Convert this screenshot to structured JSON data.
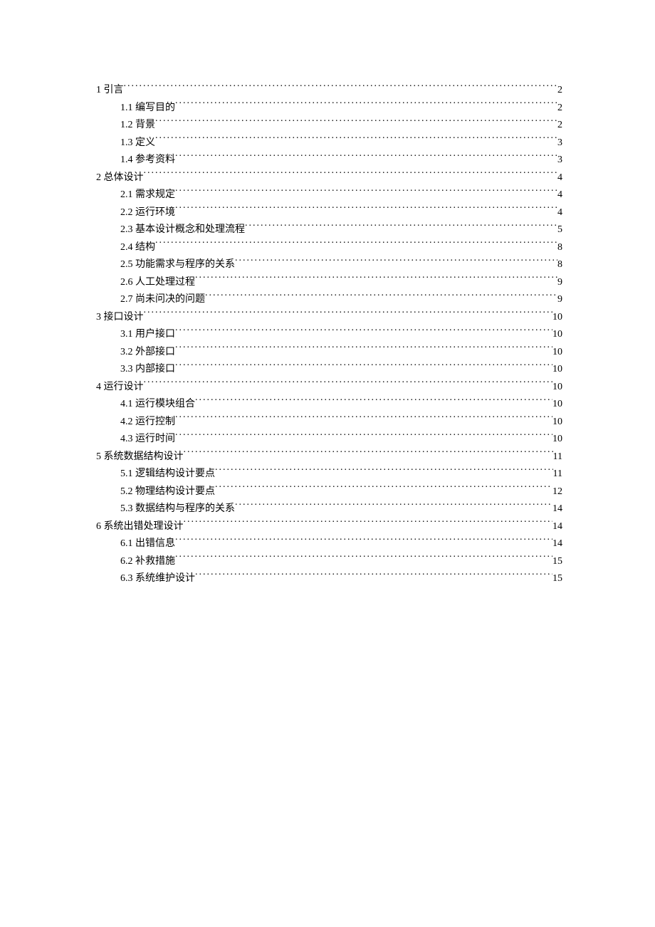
{
  "toc": [
    {
      "level": 1,
      "title": "1 引言",
      "page": "2"
    },
    {
      "level": 2,
      "title": "1.1 编写目的",
      "page": "2"
    },
    {
      "level": 2,
      "title": "1.2 背景",
      "page": "2"
    },
    {
      "level": 2,
      "title": "1.3 定义",
      "page": "3"
    },
    {
      "level": 2,
      "title": "1.4 参考资料",
      "page": "3"
    },
    {
      "level": 1,
      "title": "2 总体设计",
      "page": "4"
    },
    {
      "level": 2,
      "title": "2.1 需求规定",
      "page": "4"
    },
    {
      "level": 2,
      "title": "2.2 运行环境",
      "page": "4"
    },
    {
      "level": 2,
      "title": "2.3 基本设计概念和处理流程",
      "page": "5"
    },
    {
      "level": 2,
      "title": "2.4 结构",
      "page": "8"
    },
    {
      "level": 2,
      "title": "2.5 功能需求与程序的关系",
      "page": "8"
    },
    {
      "level": 2,
      "title": "2.6 人工处理过程",
      "page": "9"
    },
    {
      "level": 2,
      "title": "2.7 尚未问决的问题",
      "page": "9"
    },
    {
      "level": 1,
      "title": "3 接口设计",
      "page": "10"
    },
    {
      "level": 2,
      "title": "3.1 用户接口",
      "page": "10"
    },
    {
      "level": 2,
      "title": "3.2 外部接口",
      "page": "10"
    },
    {
      "level": 2,
      "title": "3.3 内部接口",
      "page": "10"
    },
    {
      "level": 1,
      "title": "4 运行设计",
      "page": "10"
    },
    {
      "level": 2,
      "title": "4.1 运行模块组合",
      "page": "10"
    },
    {
      "level": 2,
      "title": "4.2 运行控制",
      "page": "10"
    },
    {
      "level": 2,
      "title": "4.3 运行时间",
      "page": "10"
    },
    {
      "level": 1,
      "title": "5 系统数据结构设计",
      "page": "11"
    },
    {
      "level": 2,
      "title": "5.1 逻辑结构设计要点",
      "page": "11"
    },
    {
      "level": 2,
      "title": "5.2 物理结构设计要点",
      "page": "12"
    },
    {
      "level": 2,
      "title": "5.3 数据结构与程序的关系",
      "page": "14"
    },
    {
      "level": 1,
      "title": "6 系统出错处理设计",
      "page": "14"
    },
    {
      "level": 2,
      "title": "6.1 出错信息",
      "page": "14"
    },
    {
      "level": 2,
      "title": "6.2 补救措施",
      "page": "15"
    },
    {
      "level": 2,
      "title": "6.3 系统维护设计",
      "page": "15"
    }
  ]
}
